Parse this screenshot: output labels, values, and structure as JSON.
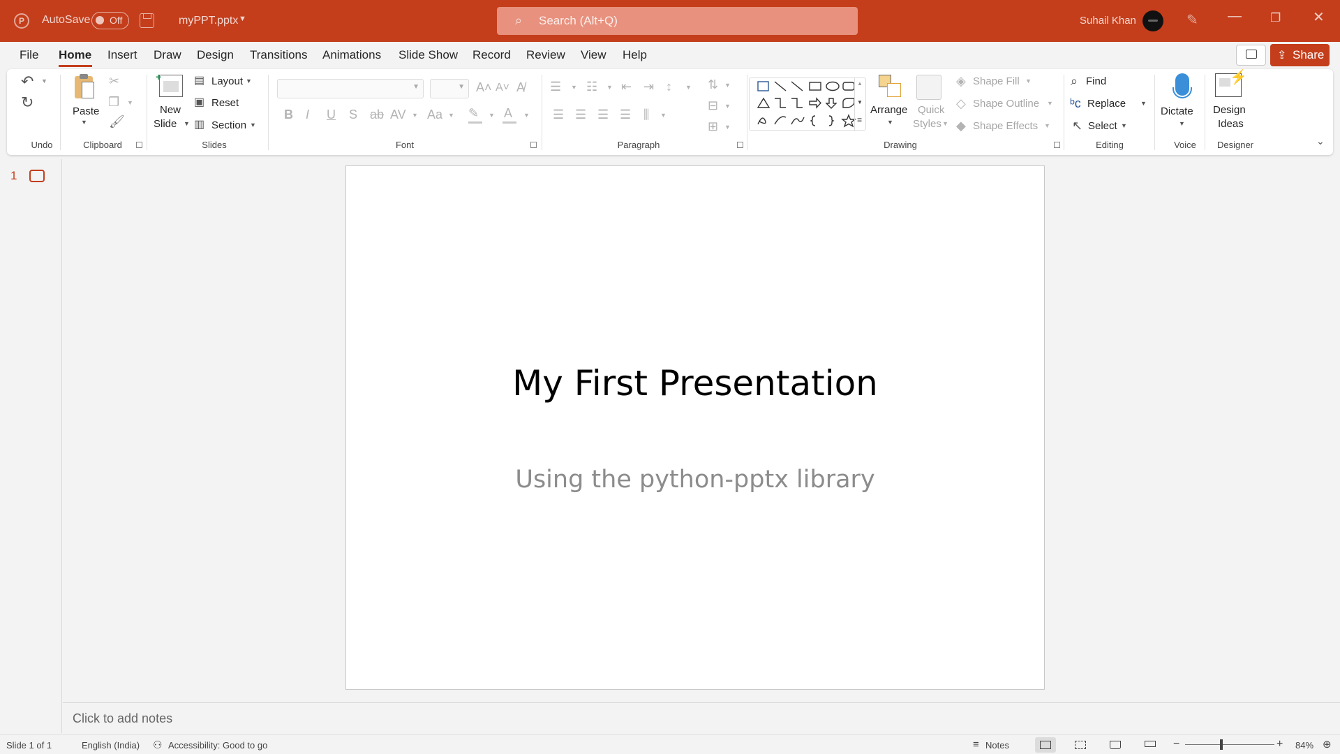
{
  "titlebar": {
    "autosave_label": "AutoSave",
    "autosave_state": "Off",
    "file_name": "myPPT.pptx",
    "search_placeholder": "Search (Alt+Q)",
    "user_name": "Suhail Khan"
  },
  "tabs": [
    "File",
    "Home",
    "Insert",
    "Draw",
    "Design",
    "Transitions",
    "Animations",
    "Slide Show",
    "Record",
    "Review",
    "View",
    "Help"
  ],
  "active_tab": "Home",
  "share_label": "Share",
  "ribbon": {
    "undo": {
      "group": "Undo"
    },
    "clipboard": {
      "group": "Clipboard",
      "paste": "Paste"
    },
    "slides": {
      "group": "Slides",
      "new_slide_1": "New",
      "new_slide_2": "Slide",
      "layout": "Layout",
      "reset": "Reset",
      "section": "Section"
    },
    "font": {
      "group": "Font"
    },
    "paragraph": {
      "group": "Paragraph"
    },
    "drawing": {
      "group": "Drawing",
      "arrange": "Arrange",
      "quick_styles_1": "Quick",
      "quick_styles_2": "Styles",
      "shape_fill": "Shape Fill",
      "shape_outline": "Shape Outline",
      "shape_effects": "Shape Effects"
    },
    "editing": {
      "group": "Editing",
      "find": "Find",
      "replace": "Replace",
      "select": "Select"
    },
    "voice": {
      "group": "Voice",
      "dictate": "Dictate"
    },
    "designer": {
      "group": "Designer",
      "design_ideas_1": "Design",
      "design_ideas_2": "Ideas"
    }
  },
  "thumbnails": {
    "slide_number": "1"
  },
  "slide": {
    "title": "My First Presentation",
    "subtitle": "Using the python-pptx library"
  },
  "notes_placeholder": "Click to add notes",
  "status": {
    "slide_info": "Slide 1 of 1",
    "language": "English (India)",
    "accessibility": "Accessibility: Good to go",
    "notes": "Notes",
    "zoom": "84%"
  },
  "colors": {
    "accent": "#c43e1c",
    "ribbon_bg": "#ffffff",
    "window_bg": "#f3f3f3"
  },
  "icons": [
    "powerpoint-app-icon",
    "save-icon",
    "search-icon",
    "pen-icon",
    "minimize-icon",
    "restore-icon",
    "close-icon",
    "comment-icon",
    "share-icon",
    "undo-icon",
    "redo-icon",
    "paste-icon",
    "cut-icon",
    "copy-icon",
    "format-painter-icon",
    "new-slide-icon",
    "layout-icon",
    "reset-icon",
    "section-icon",
    "bullets-icon",
    "numbering-icon",
    "shapes-gallery-icon",
    "arrange-icon",
    "quick-styles-icon",
    "find-icon",
    "replace-icon",
    "select-icon",
    "microphone-icon",
    "design-ideas-icon",
    "accessibility-icon",
    "notes-icon",
    "normal-view-icon",
    "slide-sorter-icon",
    "reading-view-icon",
    "slideshow-icon",
    "fit-slide-icon"
  ]
}
